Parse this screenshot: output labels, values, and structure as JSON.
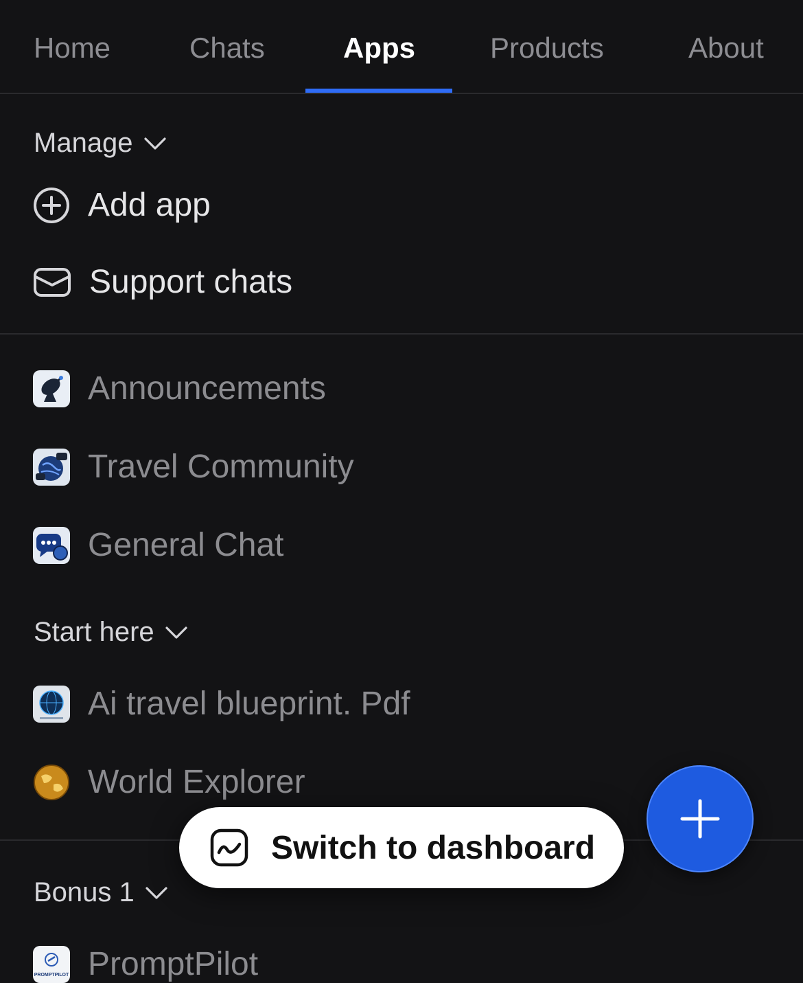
{
  "tabs": [
    {
      "label": "Home",
      "active": false
    },
    {
      "label": "Chats",
      "active": false
    },
    {
      "label": "Apps",
      "active": true
    },
    {
      "label": "Products",
      "active": false
    },
    {
      "label": "About",
      "active": false
    }
  ],
  "manage": {
    "header": "Manage",
    "items": [
      {
        "label": "Add app",
        "icon": "plus-circle-icon"
      },
      {
        "label": "Support chats",
        "icon": "envelope-icon"
      }
    ]
  },
  "apps_top": [
    {
      "label": "Announcements",
      "icon": "satellite-dish-icon"
    },
    {
      "label": "Travel Community",
      "icon": "globe-chat-icon"
    },
    {
      "label": "General Chat",
      "icon": "chat-bubbles-icon"
    }
  ],
  "start_here": {
    "header": "Start here",
    "items": [
      {
        "label": "Ai travel blueprint. Pdf",
        "icon": "blue-globe-icon"
      },
      {
        "label": "World Explorer",
        "icon": "gold-globe-icon"
      }
    ]
  },
  "bonus": {
    "header": "Bonus 1",
    "items": [
      {
        "label": "PromptPilot",
        "icon": "promptpilot-logo-icon",
        "logo_text": "PROMPTPILOT"
      }
    ]
  },
  "pill": {
    "label": "Switch to dashboard",
    "icon": "chart-icon"
  },
  "fab": {
    "icon": "plus-icon"
  },
  "colors": {
    "accent": "#2f6cf6",
    "fab": "#1e5be0",
    "background": "#131315"
  }
}
